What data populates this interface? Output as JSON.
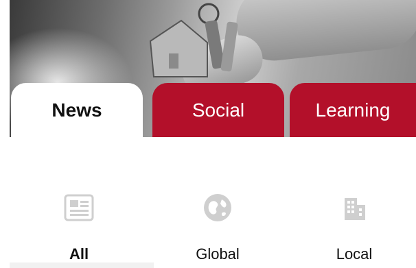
{
  "tabs": [
    {
      "label": "News",
      "active": true
    },
    {
      "label": "Social",
      "active": false
    },
    {
      "label": "Learning",
      "active": false
    }
  ],
  "categories": [
    {
      "label": "All",
      "icon": "newspaper-icon",
      "selected": true
    },
    {
      "label": "Global",
      "icon": "globe-icon",
      "selected": false
    },
    {
      "label": "Local",
      "icon": "building-icon",
      "selected": false
    }
  ],
  "colors": {
    "accent": "#b3102a",
    "icon": "#cfcfcf"
  }
}
